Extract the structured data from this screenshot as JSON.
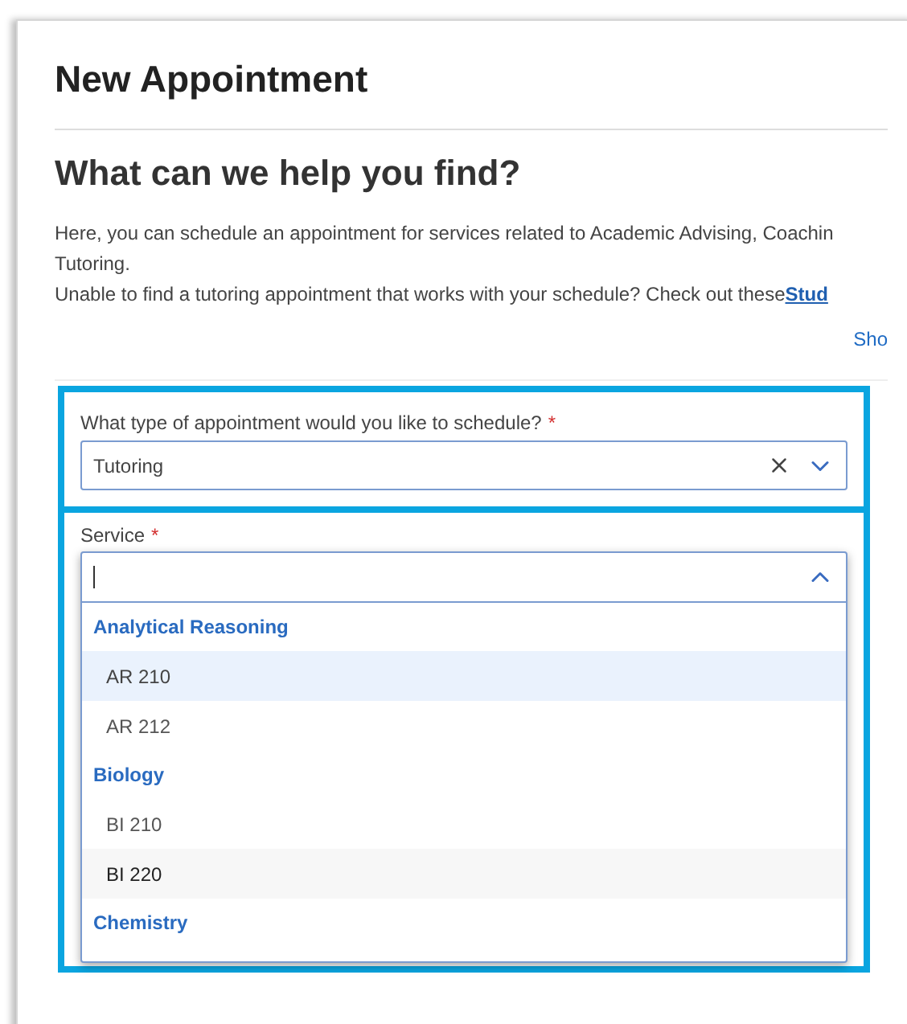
{
  "title": "New Appointment",
  "subtitle": "What can we help you find?",
  "intro_lines": [
    "Here, you can schedule an appointment for services related to Academic Advising, Coachin",
    "Tutoring."
  ],
  "tutoring_note": {
    "text": "Unable to find a tutoring appointment that works with your schedule? Check out these ",
    "link": "Stud"
  },
  "show_link": "Sho",
  "type_field": {
    "label": "What type of appointment would you like to schedule?",
    "required": true,
    "required_mark": "*",
    "value": "Tutoring"
  },
  "service_field": {
    "label": "Service",
    "required": true,
    "required_mark": "*",
    "expanded": true,
    "options": [
      {
        "kind": "group",
        "label": "Analytical Reasoning"
      },
      {
        "kind": "option",
        "label": "AR 210",
        "highlighted": true,
        "hovered": false
      },
      {
        "kind": "option",
        "label": "AR 212",
        "highlighted": false,
        "hovered": false
      },
      {
        "kind": "group",
        "label": "Biology"
      },
      {
        "kind": "option",
        "label": "BI 210",
        "highlighted": false,
        "hovered": false
      },
      {
        "kind": "option",
        "label": "BI 220",
        "highlighted": false,
        "hovered": true
      },
      {
        "kind": "group",
        "label": "Chemistry"
      }
    ]
  }
}
